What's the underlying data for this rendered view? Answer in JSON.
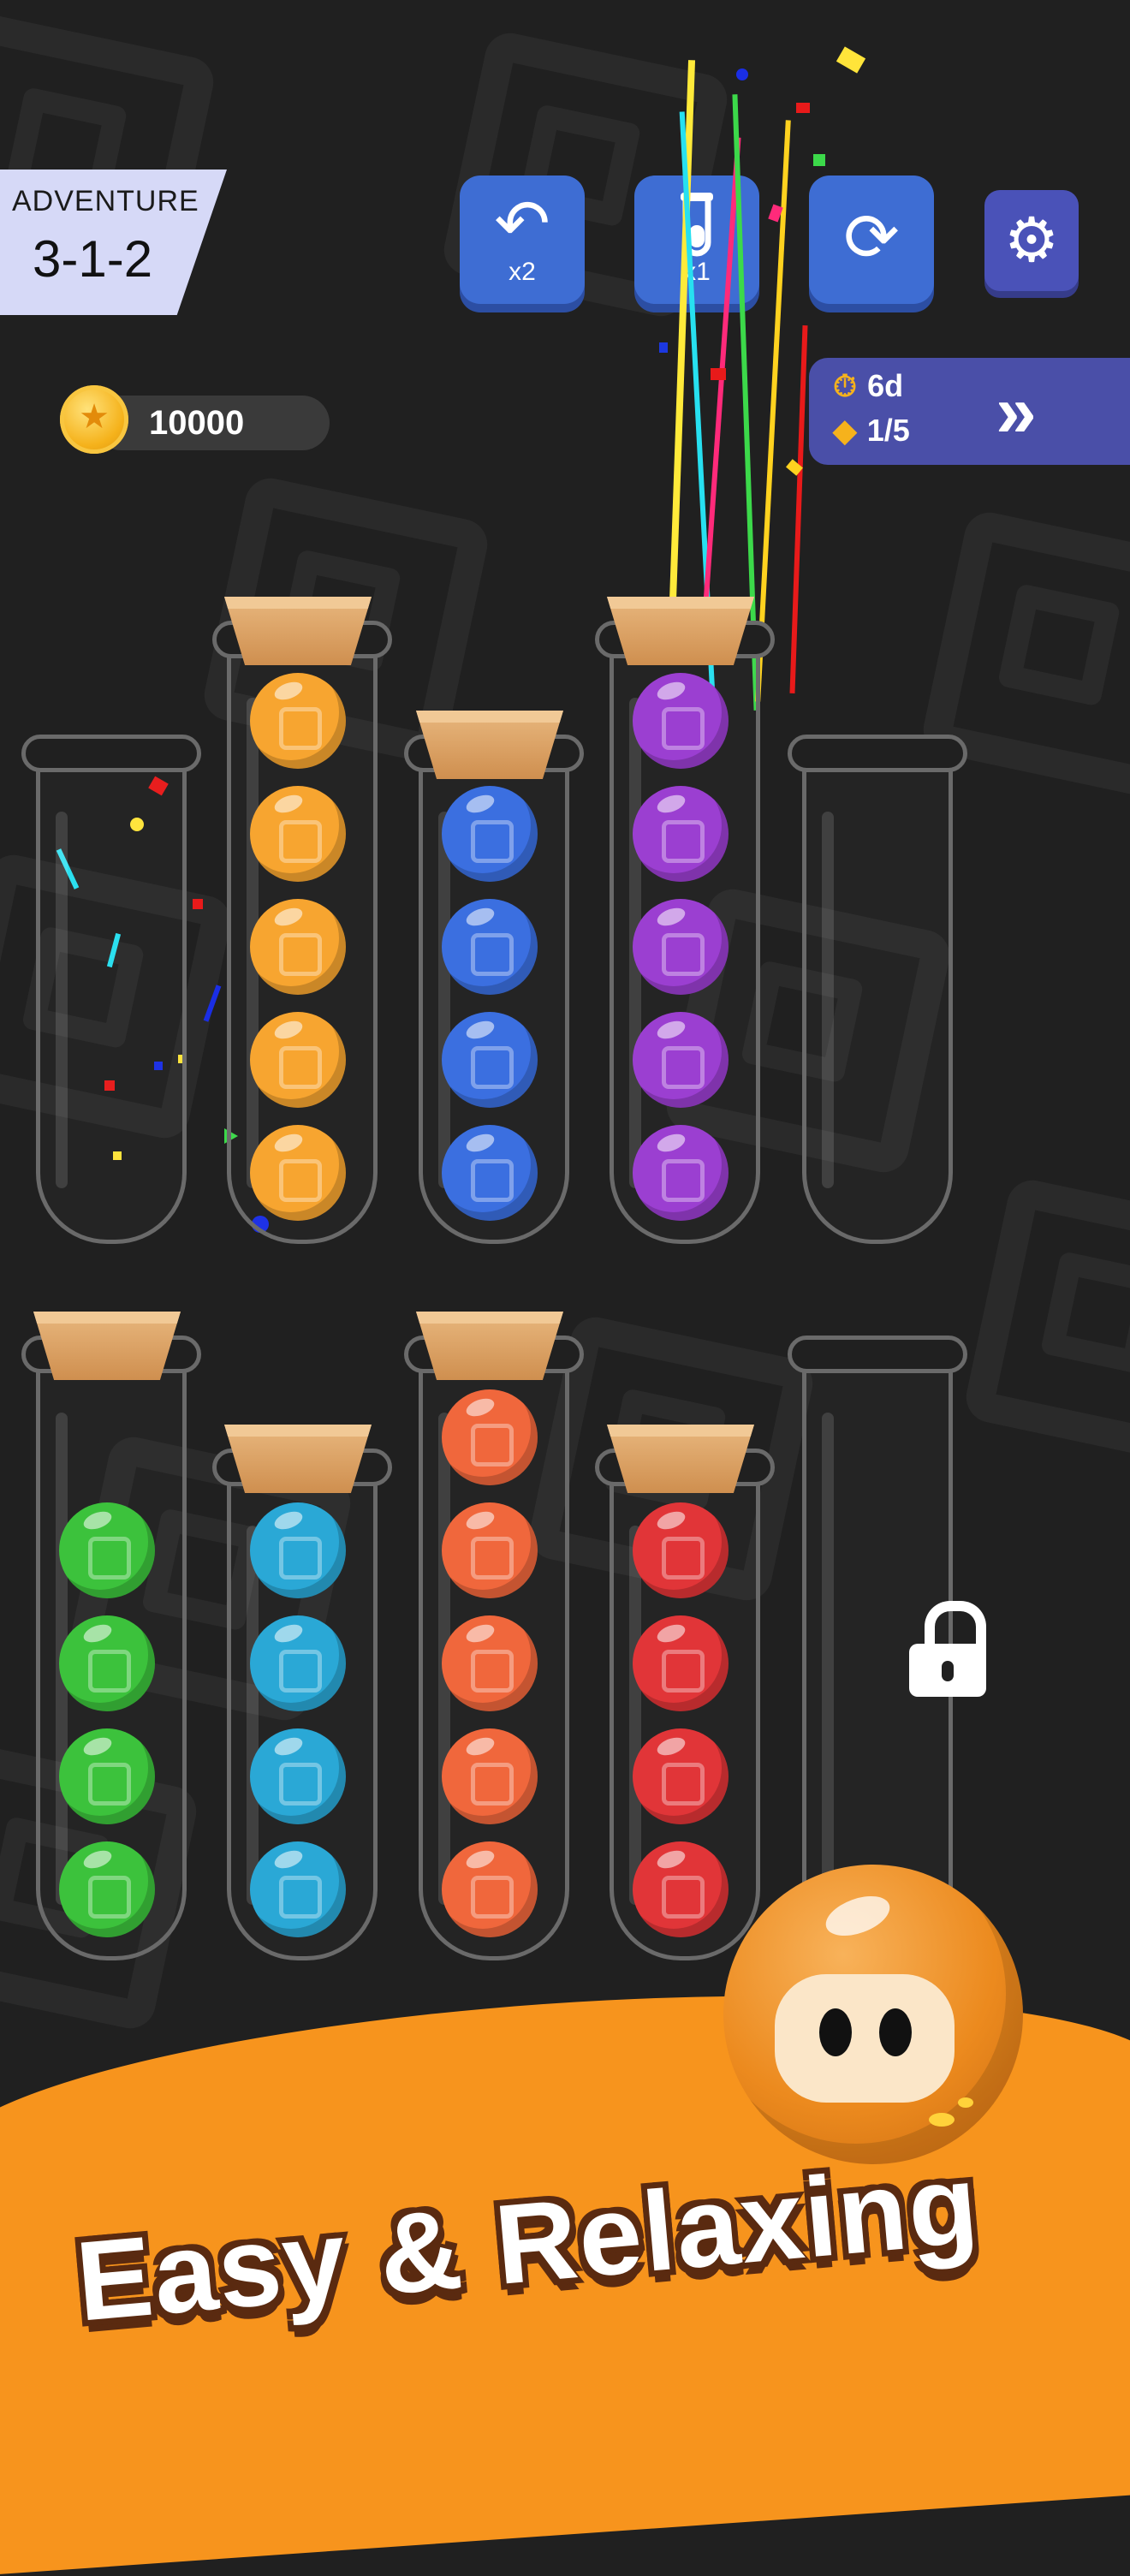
{
  "level": {
    "mode": "ADVENTURE",
    "number": "3-1-2"
  },
  "coins": {
    "value": "10000",
    "icon": "coin-icon"
  },
  "toolbar": {
    "undo": {
      "icon": "undo-arrow-icon",
      "count": "x2"
    },
    "extra_tube": {
      "icon": "test-tube-icon",
      "count": "x1"
    },
    "restart": {
      "icon": "refresh-icon"
    },
    "settings": {
      "icon": "gear-icon"
    }
  },
  "event": {
    "timer": "6d",
    "tickets": "1/5",
    "timer_icon": "stopwatch-icon",
    "ticket_icon": "ticket-icon",
    "action_icon": "double-chevron-icon"
  },
  "colors": {
    "orange": "#f7a530",
    "blue": "#3b6fe0",
    "purple": "#9b3fd1",
    "green": "#3cc23c",
    "cyan": "#2aa8d6",
    "coral": "#f0673c",
    "red": "#e13538",
    "accent": "#f7941d",
    "button_blue": "#3e6dd3",
    "panel_purple": "#4a4fa8"
  },
  "tubes": [
    {
      "id": "r1c1",
      "capped": false,
      "balls": []
    },
    {
      "id": "r1c2",
      "capped": true,
      "balls": [
        "orange",
        "orange",
        "orange",
        "orange",
        "orange"
      ]
    },
    {
      "id": "r1c3",
      "capped": true,
      "balls": [
        "blue",
        "blue",
        "blue",
        "blue"
      ]
    },
    {
      "id": "r1c4",
      "capped": true,
      "balls": [
        "purple",
        "purple",
        "purple",
        "purple",
        "purple"
      ]
    },
    {
      "id": "r1c5",
      "capped": false,
      "balls": []
    },
    {
      "id": "r2c1",
      "capped": true,
      "balls": [
        "green",
        "green",
        "green",
        "green"
      ]
    },
    {
      "id": "r2c2",
      "capped": true,
      "balls": [
        "cyan",
        "cyan",
        "cyan",
        "cyan"
      ]
    },
    {
      "id": "r2c3",
      "capped": true,
      "balls": [
        "coral",
        "coral",
        "coral",
        "coral",
        "coral"
      ]
    },
    {
      "id": "r2c4",
      "capped": true,
      "balls": [
        "red",
        "red",
        "red",
        "red"
      ]
    },
    {
      "id": "r2c5",
      "capped": false,
      "locked": true,
      "balls": []
    }
  ],
  "lock_icon": "padlock-icon",
  "mascot": "orange-ball-mascot",
  "slogan": "Easy & Relaxing"
}
